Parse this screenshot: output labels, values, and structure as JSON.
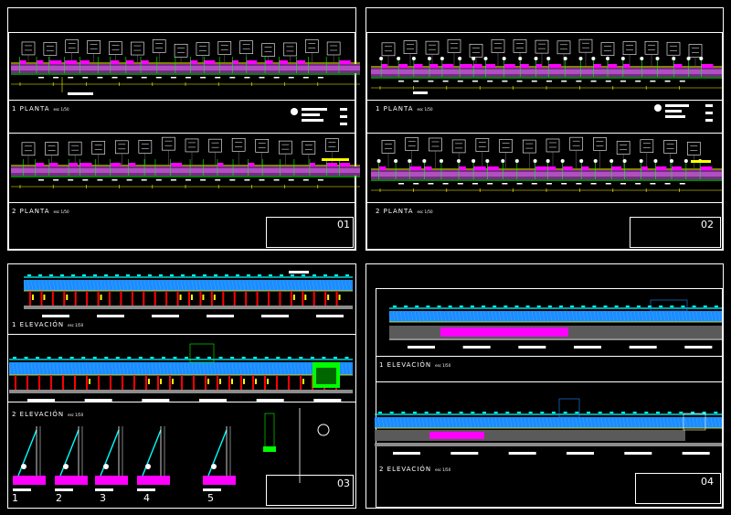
{
  "sheets": [
    {
      "number": "01",
      "labels": [
        {
          "text": "1 PLANTA",
          "scale": "esc 1/50"
        },
        {
          "text": "2 PLANTA",
          "scale": "esc 1/50"
        }
      ]
    },
    {
      "number": "02",
      "labels": [
        {
          "text": "1 PLANTA",
          "scale": "esc 1/50"
        },
        {
          "text": "2 PLANTA",
          "scale": "esc 1/50"
        }
      ]
    },
    {
      "number": "03",
      "labels": [
        {
          "text": "1 ELEVACIÓN",
          "scale": "esc 1/50"
        },
        {
          "text": "2 ELEVACIÓN",
          "scale": "esc 1/50"
        }
      ]
    },
    {
      "number": "04",
      "labels": [
        {
          "text": "1 ELEVACIÓN",
          "scale": "esc 1/50"
        },
        {
          "text": "2 ELEVACIÓN",
          "scale": "esc 1/50"
        }
      ]
    }
  ],
  "details": [
    "1",
    "2",
    "3",
    "4",
    "5"
  ],
  "colors": {
    "background": "#000000",
    "line": "#ffffff",
    "yellow": "#ffff00",
    "green": "#00ff00",
    "magenta": "#ff00ff",
    "cyan": "#00ffff",
    "blue": "#1a8cff",
    "red": "#ff0000",
    "gray": "#8c8c8c",
    "purple": "#7a2a8a"
  }
}
